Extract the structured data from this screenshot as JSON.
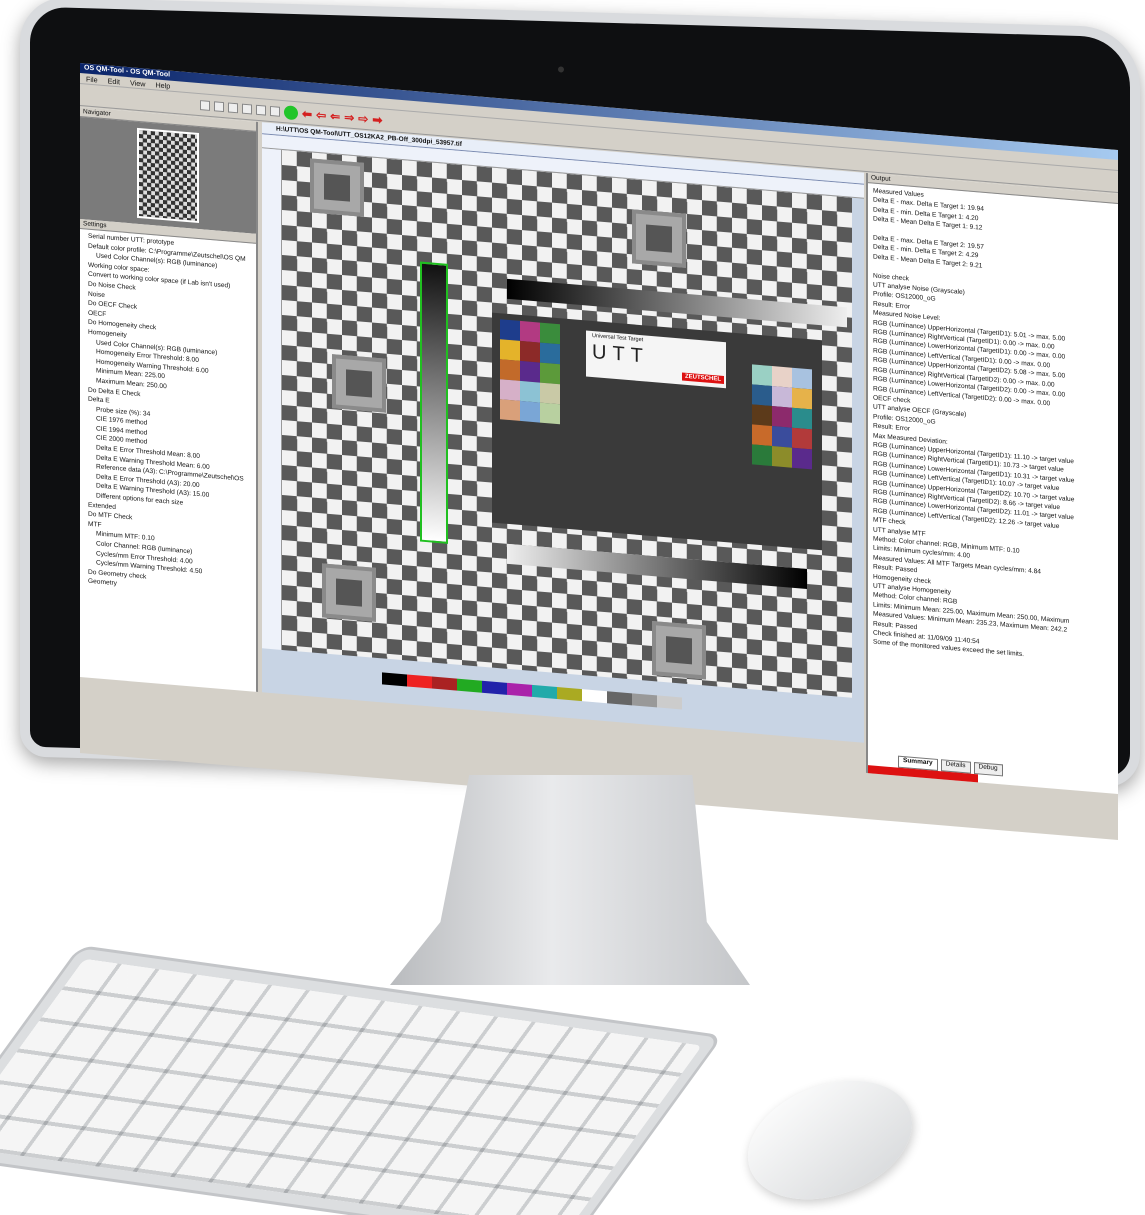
{
  "app": {
    "title": "OS QM-Tool - OS QM-Tool"
  },
  "menu": [
    "File",
    "Edit",
    "View",
    "Help"
  ],
  "panels": {
    "navigator": "Navigator",
    "settings": "Settings",
    "output": "Output"
  },
  "document": {
    "tab": "H:\\UTT\\OS QM-Tool\\UTT_OS12KA2_PB-Off_300dpi_53957.tif"
  },
  "settings_items": [
    "Serial number UTT: prototype",
    "Default color profile: C:\\Programme\\Zeutschel\\OS QM",
    "Used Color Channel(s): RGB (luminance)",
    "Working color space:",
    "Convert to working color space (if Lab isn't used)",
    "Do Noise Check",
    "Noise",
    "Do OECF Check",
    "OECF",
    "Do Homogeneity check",
    "Homogeneity",
    "Used Color Channel(s): RGB (luminance)",
    "Homogeneity Error Threshold: 8.00",
    "Homogeneity Warning Threshold: 6.00",
    "Minimum Mean: 225.00",
    "Maximum Mean: 250.00",
    "Do Delta E Check",
    "Delta E",
    "Probe size (%): 34",
    "CIE 1976 method",
    "CIE 1994 method",
    "CIE 2000 method",
    "Delta E Error Threshold Mean: 8.00",
    "Delta E Warning Threshold Mean: 6.00",
    "Reference data (A3): C:\\Programme\\Zeutschel\\OS",
    "Delta E Error Threshold (A3): 20.00",
    "Delta E Warning Threshold (A3): 15.00",
    "Different options for each size",
    "Extended",
    "Do MTF Check",
    "MTF",
    "Minimum MTF: 0.10",
    "Color Channel: RGB (luminance)",
    "Cycles/mm Error Threshold: 4.00",
    "Cycles/mm Warning Threshold: 4.50",
    "Do Geometry check",
    "Geometry"
  ],
  "output_lines": [
    "Measured Values",
    "Delta E - max. Delta E Target 1: 19.94",
    "Delta E - min. Delta E Target 1: 4.20",
    "Delta E - Mean Delta E Target 1: 9.12",
    "",
    "Delta E - max. Delta E Target 2: 19.57",
    "Delta E - min. Delta E Target 2: 4.29",
    "Delta E - Mean Delta E Target 2: 9.21",
    "",
    "Noise check",
    "UTT analyse Noise (Grayscale)",
    "Profile: OS12000_oG",
    "Result: Error",
    "Measured Noise Level:",
    "RGB (Luminance) UpperHorizontal (TargetID1): 5.01 -> max. 5.00",
    "RGB (Luminance) RightVertical (TargetID1): 0.00 -> max. 0.00",
    "RGB (Luminance) LowerHorizontal (TargetID1): 0.00 -> max. 0.00",
    "RGB (Luminance) LeftVertical (TargetID1): 0.00 -> max. 0.00",
    "RGB (Luminance) UpperHorizontal (TargetID2): 5.08 -> max. 5.00",
    "RGB (Luminance) RightVertical (TargetID2): 0.00 -> max. 0.00",
    "RGB (Luminance) LowerHorizontal (TargetID2): 0.00 -> max. 0.00",
    "RGB (Luminance) LeftVertical (TargetID2): 0.00 -> max. 0.00",
    "OECF check",
    "UTT analyse OECF (Grayscale)",
    "Profile: OS12000_oG",
    "Result: Error",
    "Max Measured Deviation:",
    "RGB (Luminance) UpperHorizontal (TargetID1): 11.10 -> target value",
    "RGB (Luminance) RightVertical (TargetID1): 10.73 -> target value",
    "RGB (Luminance) LowerHorizontal (TargetID1): 10.31 -> target value",
    "RGB (Luminance) LeftVertical (TargetID1): 10.07 -> target value",
    "RGB (Luminance) UpperHorizontal (TargetID2): 10.70 -> target value",
    "RGB (Luminance) RightVertical (TargetID2): 8.66 -> target value",
    "RGB (Luminance) LowerHorizontal (TargetID2): 11.01 -> target value",
    "RGB (Luminance) LeftVertical (TargetID2): 12.26 -> target value",
    "MTF check",
    "UTT analyse MTF",
    "Method: Color channel: RGB, Minimum MTF: 0.10",
    "Limits: Minimum cycles/mm: 4.00",
    "Measured Values: All MTF Targets Mean cycles/mm: 4.84",
    "Result: Passed",
    "Homogeneity check",
    "UTT analyse Homogeneity",
    "Method: Color channel: RGB",
    "Limits: Minimum Mean: 225.00, Maximum Mean: 250.00, Maximum",
    "Measured Values: Minimum Mean: 235.23, Maximum Mean: 242.2",
    "Result: Passed",
    "Check finished at: 11/09/09 11:40:54",
    "Some of the monitored values exceed the set limits."
  ],
  "output_tabs": [
    "Summary",
    "Details",
    "Debug"
  ],
  "logo": {
    "title": "Universal Test Target",
    "utt": "UTT",
    "brand": "ZEUTSCHEL"
  }
}
